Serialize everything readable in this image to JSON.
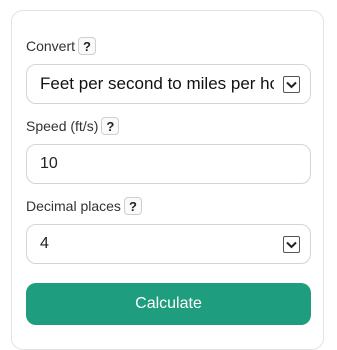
{
  "convert": {
    "label": "Convert",
    "help": "?",
    "selected": "Feet per second to miles per hour"
  },
  "speed": {
    "label": "Speed (ft/s)",
    "help": "?",
    "value": "10"
  },
  "decimals": {
    "label": "Decimal places",
    "help": "?",
    "selected": "4"
  },
  "calculate_label": "Calculate",
  "colors": {
    "accent": "#1e9e7e",
    "border": "#d4d4d4"
  }
}
